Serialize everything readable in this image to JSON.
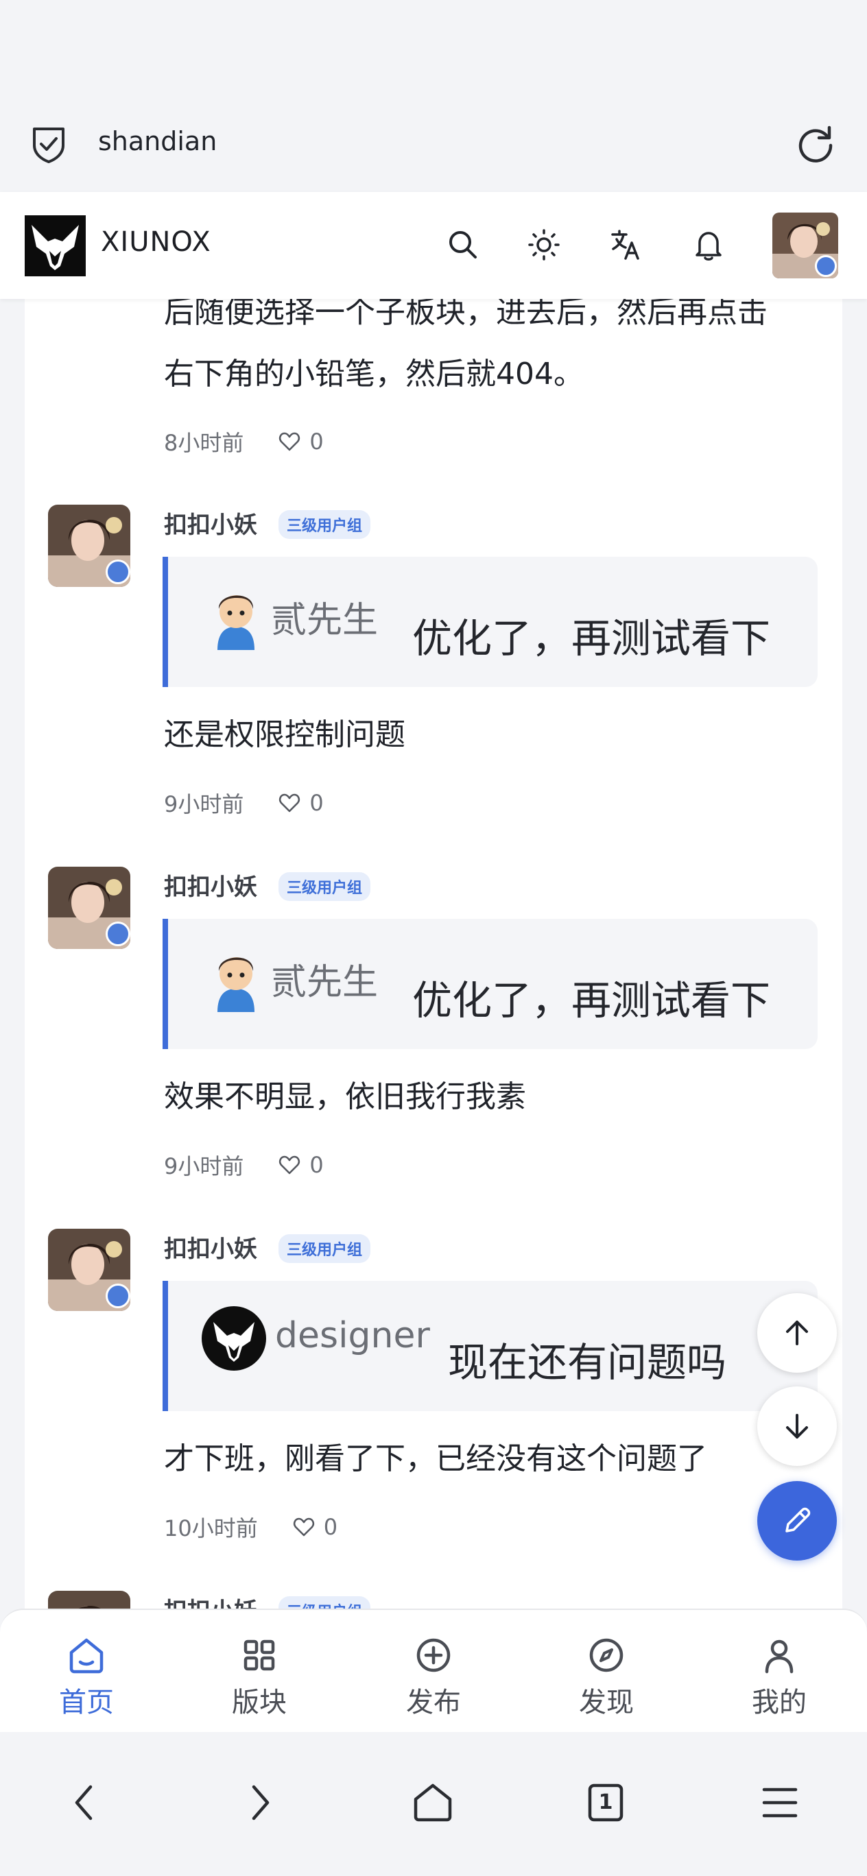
{
  "browser": {
    "url_text": "shandian"
  },
  "site": {
    "brand": "XIUNOX"
  },
  "posts": [
    {
      "body_lines": [
        "后随便选择一个子板块，进去后，然后再点击",
        "右下角的小铅笔，然后就404。"
      ],
      "time": "8小时前",
      "likes": "0"
    },
    {
      "author": "扣扣小妖",
      "group": "三级用户组",
      "quote_author": "贰先生",
      "quote_text": "优化了，再测试看下",
      "body": "还是权限控制问题",
      "time": "9小时前",
      "likes": "0"
    },
    {
      "author": "扣扣小妖",
      "group": "三级用户组",
      "quote_author": "贰先生",
      "quote_text": "优化了，再测试看下",
      "body": "效果不明显，依旧我行我素",
      "time": "9小时前",
      "likes": "0"
    },
    {
      "author": "扣扣小妖",
      "group": "三级用户组",
      "quote_author": "designer",
      "quote_text": "现在还有问题吗",
      "body": "才下班，刚看了下，已经没有这个问题了",
      "time": "10小时前",
      "likes": "0"
    },
    {
      "author": "扣扣小妖",
      "group": "三级用户组"
    }
  ],
  "tabs": [
    {
      "label": "首页",
      "icon": "home-icon",
      "active": true
    },
    {
      "label": "版块",
      "icon": "grid-icon",
      "active": false
    },
    {
      "label": "发布",
      "icon": "plus-circle-icon",
      "active": false
    },
    {
      "label": "发现",
      "icon": "compass-icon",
      "active": false
    },
    {
      "label": "我的",
      "icon": "user-icon",
      "active": false
    }
  ],
  "system_nav": {
    "tab_count": "1"
  },
  "colors": {
    "accent": "#3e6cd9",
    "badge_bg": "#e7eefb"
  }
}
